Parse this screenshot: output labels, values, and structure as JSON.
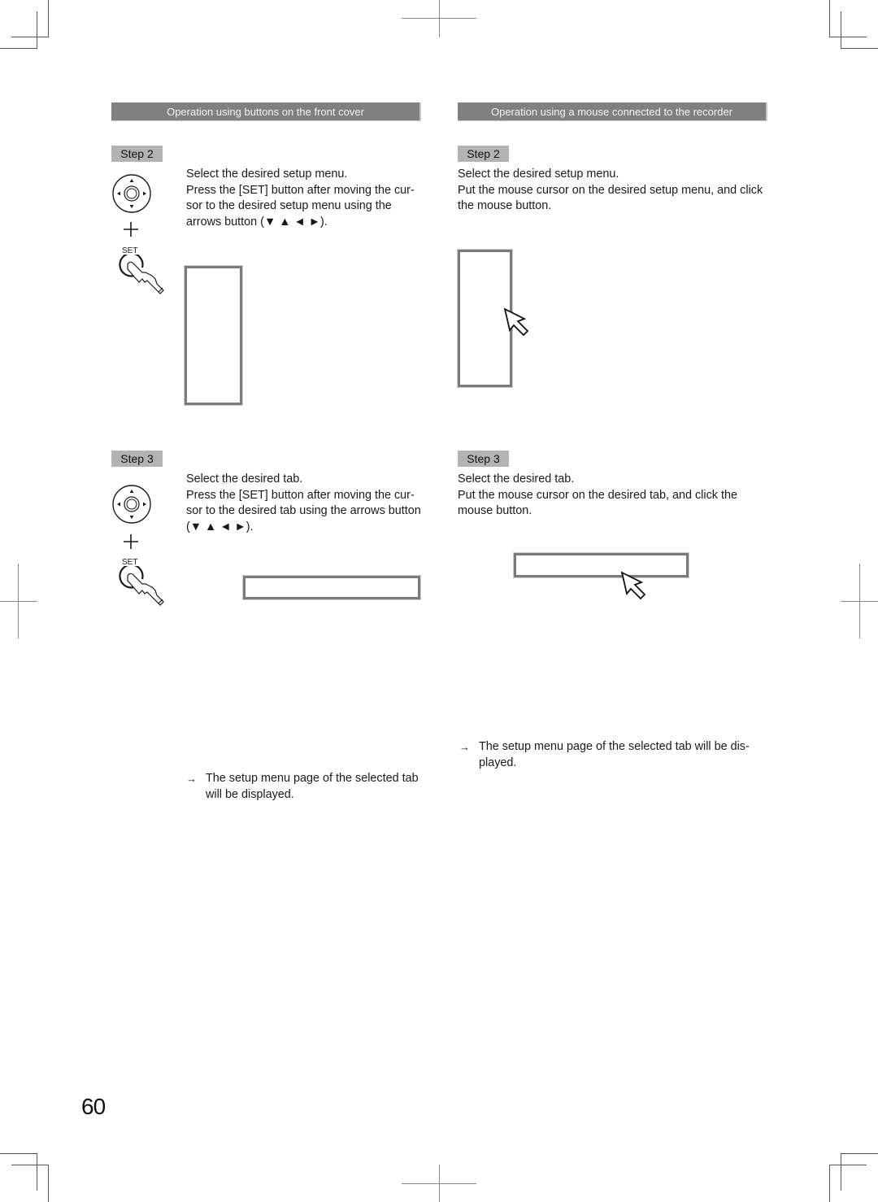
{
  "page": {
    "page_number": "60"
  },
  "left_column": {
    "header": "Operation using buttons on the front cover",
    "step2": {
      "badge": "Step 2",
      "title": "Select the desired setup menu.",
      "body": "Press the [SET] button after moving the cur-sor to the desired setup menu using the arrows button (▼ ▲ ◄ ►).",
      "body_lines": [
        "Press the [SET] button after moving the cur-",
        "sor to the desired setup menu using the",
        "arrows button (▼ ▲ ◄ ►)."
      ],
      "icons": {
        "dpad": "arrows-button-icon",
        "plus": "+",
        "set_label": "SET",
        "press": "finger-press-icon"
      }
    },
    "step3": {
      "badge": "Step 3",
      "title": "Select the desired tab.",
      "body_lines": [
        "Press the [SET] button after moving the cur-",
        "sor to the desired tab using the arrows button",
        "(▼ ▲ ◄ ►)."
      ],
      "icons": {
        "dpad": "arrows-button-icon",
        "plus": "+",
        "set_label": "SET",
        "press": "finger-press-icon"
      },
      "result_arrow": "→",
      "result_lines": [
        "The setup menu page of the selected tab",
        "will be displayed."
      ]
    }
  },
  "right_column": {
    "header": "Operation using a mouse connected to the recorder",
    "step2": {
      "badge": "Step 2",
      "title": "Select the desired setup menu.",
      "body_lines": [
        "Put the mouse cursor on the desired setup menu, and click",
        "the mouse button."
      ],
      "icons": {
        "cursor": "mouse-pointer-icon"
      }
    },
    "step3": {
      "badge": "Step 3",
      "title": "Select the desired tab.",
      "body_lines": [
        "Put the mouse cursor on the desired tab, and click the",
        "mouse button."
      ],
      "icons": {
        "cursor": "mouse-pointer-icon"
      },
      "result_arrow": "→",
      "result_lines": [
        "The setup menu page of the selected tab will be dis-",
        "played."
      ]
    }
  },
  "colors": {
    "header_bg": "#808080",
    "header_text": "#f4f4f4",
    "step_badge_bg": "#b3b3b3",
    "box_border": "#7a7a7a",
    "crop_mark": "#555555"
  }
}
